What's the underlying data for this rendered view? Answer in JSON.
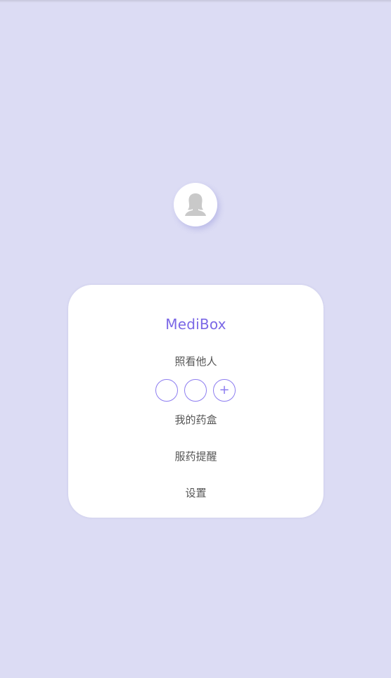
{
  "app": {
    "title": "MediBox"
  },
  "profile": {
    "avatar_icon": "user-avatar-female-icon"
  },
  "care_others": {
    "label": "照看他人",
    "slots": [
      "",
      ""
    ],
    "add_icon_glyph": "+"
  },
  "menu": {
    "my_medbox": "我的药盒",
    "reminder": "服药提醒",
    "settings": "设置"
  },
  "colors": {
    "background": "#dcdcf4",
    "accent": "#7b68e6",
    "card": "#ffffff",
    "text": "#555555"
  }
}
